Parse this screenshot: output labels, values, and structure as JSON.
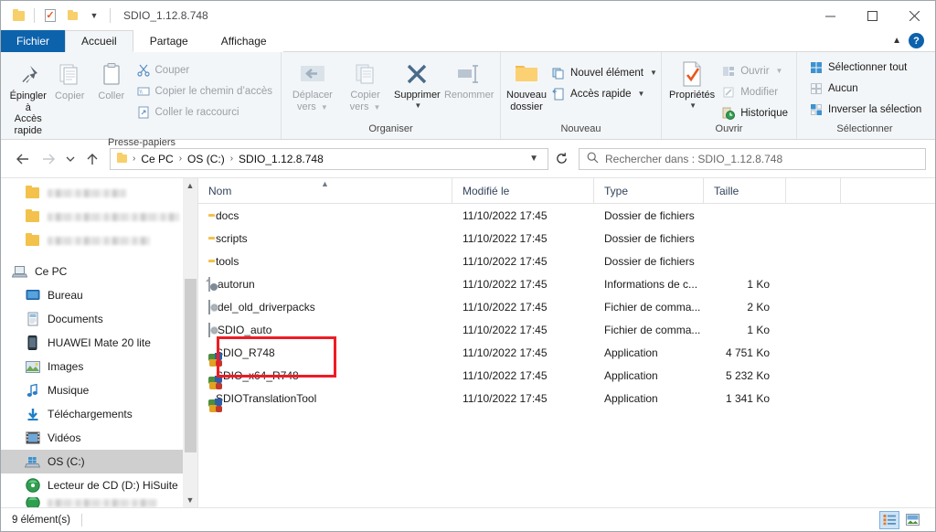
{
  "window": {
    "title": "SDIO_1.12.8.748",
    "controls": {
      "minimize": "—",
      "maximize": "□",
      "close": "✕"
    },
    "quick_access": {
      "folder_icon": "folder-icon",
      "properties_icon": "properties-icon",
      "new_folder_icon": "folder-icon",
      "dropdown_icon": "chevron-down-icon"
    }
  },
  "tabs": {
    "file": "Fichier",
    "items": [
      {
        "label": "Accueil",
        "active": true
      },
      {
        "label": "Partage",
        "active": false
      },
      {
        "label": "Affichage",
        "active": false
      }
    ],
    "collapse_icon": "chevron-up-icon",
    "help_label": "?"
  },
  "ribbon": {
    "groups": [
      {
        "name": "Presse-papiers",
        "big": [
          {
            "label_line1": "Épingler à",
            "label_line2": "Accès rapide",
            "icon": "pin-icon",
            "disabled": false
          },
          {
            "label_line1": "Copier",
            "label_line2": "",
            "icon": "copy-icon",
            "disabled": true
          },
          {
            "label_line1": "Coller",
            "label_line2": "",
            "icon": "paste-icon",
            "disabled": true
          }
        ],
        "small": [
          {
            "label": "Couper",
            "icon": "scissors-icon",
            "disabled": true
          },
          {
            "label": "Copier le chemin d’accès",
            "icon": "copy-path-icon",
            "disabled": true
          },
          {
            "label": "Coller le raccourci",
            "icon": "paste-shortcut-icon",
            "disabled": true
          }
        ]
      },
      {
        "name": "Organiser",
        "big": [
          {
            "label_line1": "Déplacer",
            "label_line2": "vers",
            "icon": "move-to-icon",
            "disabled": true,
            "caret": true
          },
          {
            "label_line1": "Copier",
            "label_line2": "vers",
            "icon": "copy-to-icon",
            "disabled": true,
            "caret": true
          },
          {
            "label_line1": "Supprimer",
            "label_line2": "",
            "icon": "delete-icon",
            "disabled": false,
            "caret": true
          },
          {
            "label_line1": "Renommer",
            "label_line2": "",
            "icon": "rename-icon",
            "disabled": true
          }
        ],
        "small": []
      },
      {
        "name": "Nouveau",
        "big": [
          {
            "label_line1": "Nouveau",
            "label_line2": "dossier",
            "icon": "new-folder-icon",
            "disabled": false
          }
        ],
        "small": [
          {
            "label": "Nouvel élément",
            "icon": "new-item-icon",
            "disabled": false,
            "caret": true
          },
          {
            "label": "Accès rapide",
            "icon": "easy-access-icon",
            "disabled": false,
            "caret": true
          }
        ]
      },
      {
        "name": "Ouvrir",
        "big": [
          {
            "label_line1": "Propriétés",
            "label_line2": "",
            "icon": "properties-icon",
            "disabled": false,
            "caret": true
          }
        ],
        "small": [
          {
            "label": "Ouvrir",
            "icon": "open-icon",
            "disabled": true,
            "caret": true
          },
          {
            "label": "Modifier",
            "icon": "edit-icon",
            "disabled": true
          },
          {
            "label": "Historique",
            "icon": "history-icon",
            "disabled": false
          }
        ]
      },
      {
        "name": "Sélectionner",
        "big": [],
        "small": [
          {
            "label": "Sélectionner tout",
            "icon": "select-all-icon",
            "disabled": false
          },
          {
            "label": "Aucun",
            "icon": "select-none-icon",
            "disabled": false
          },
          {
            "label": "Inverser la sélection",
            "icon": "invert-selection-icon",
            "disabled": false
          }
        ]
      }
    ]
  },
  "address": {
    "back_icon": "back-arrow-icon",
    "forward_icon": "forward-arrow-icon",
    "recent_icon": "chevron-down-icon",
    "up_icon": "up-arrow-icon",
    "breadcrumbs": [
      "Ce PC",
      "OS (C:)",
      "SDIO_1.12.8.748"
    ],
    "separator": "›",
    "dropdown_icon": "chevron-down-icon",
    "refresh_icon": "refresh-icon"
  },
  "search": {
    "icon": "search-icon",
    "placeholder": "Rechercher dans : SDIO_1.12.8.748"
  },
  "navpane": {
    "items": [
      {
        "label": "",
        "icon": "folder-icon",
        "blurred": true,
        "indent": "child",
        "blur_width": 86
      },
      {
        "label": "",
        "icon": "folder-icon",
        "blurred": true,
        "indent": "child",
        "blur_width": 144
      },
      {
        "label": "",
        "icon": "folder-icon",
        "blurred": true,
        "indent": "child",
        "blur_width": 112
      },
      {
        "label": "Ce PC",
        "icon": "computer-icon",
        "blurred": false,
        "indent": "root",
        "selected": false
      },
      {
        "label": "Bureau",
        "icon": "desktop-icon",
        "blurred": false,
        "indent": "child",
        "selected": false
      },
      {
        "label": "Documents",
        "icon": "documents-icon",
        "blurred": false,
        "indent": "child",
        "selected": false
      },
      {
        "label": "HUAWEI Mate 20 lite",
        "icon": "phone-icon",
        "blurred": false,
        "indent": "child",
        "selected": false
      },
      {
        "label": "Images",
        "icon": "pictures-icon",
        "blurred": false,
        "indent": "child",
        "selected": false
      },
      {
        "label": "Musique",
        "icon": "music-icon",
        "blurred": false,
        "indent": "child",
        "selected": false
      },
      {
        "label": "Téléchargements",
        "icon": "downloads-icon",
        "blurred": false,
        "indent": "child",
        "selected": false
      },
      {
        "label": "Vidéos",
        "icon": "videos-icon",
        "blurred": false,
        "indent": "child",
        "selected": false
      },
      {
        "label": "OS (C:)",
        "icon": "drive-icon",
        "blurred": false,
        "indent": "child",
        "selected": true
      },
      {
        "label": "Lecteur de CD (D:) HiSuite",
        "icon": "cd-drive-icon",
        "blurred": false,
        "indent": "child",
        "selected": false
      }
    ],
    "scroll_up_icon": "chevron-up-icon",
    "scroll_down_icon": "chevron-down-icon"
  },
  "filelist": {
    "columns": [
      {
        "label": "Nom",
        "sorted": true,
        "sort_icon": "sort-ascending-icon"
      },
      {
        "label": "Modifié le",
        "sorted": false
      },
      {
        "label": "Type",
        "sorted": false
      },
      {
        "label": "Taille",
        "sorted": false
      }
    ],
    "rows": [
      {
        "name": "docs",
        "modified": "11/10/2022 17:45",
        "type": "Dossier de fichiers",
        "size": "",
        "icon": "folder-icon"
      },
      {
        "name": "scripts",
        "modified": "11/10/2022 17:45",
        "type": "Dossier de fichiers",
        "size": "",
        "icon": "folder-icon"
      },
      {
        "name": "tools",
        "modified": "11/10/2022 17:45",
        "type": "Dossier de fichiers",
        "size": "",
        "icon": "folder-icon"
      },
      {
        "name": "autorun",
        "modified": "11/10/2022 17:45",
        "type": "Informations de c...",
        "size": "1 Ko",
        "icon": "config-file-icon"
      },
      {
        "name": "del_old_driverpacks",
        "modified": "11/10/2022 17:45",
        "type": "Fichier de comma...",
        "size": "2 Ko",
        "icon": "batch-file-icon"
      },
      {
        "name": "SDIO_auto",
        "modified": "11/10/2022 17:45",
        "type": "Fichier de comma...",
        "size": "1 Ko",
        "icon": "batch-file-icon"
      },
      {
        "name": "SDIO_R748",
        "modified": "11/10/2022 17:45",
        "type": "Application",
        "size": "4 751 Ko",
        "icon": "application-icon"
      },
      {
        "name": "SDIO_x64_R748",
        "modified": "11/10/2022 17:45",
        "type": "Application",
        "size": "5 232 Ko",
        "icon": "application-icon"
      },
      {
        "name": "SDIOTranslationTool",
        "modified": "11/10/2022 17:45",
        "type": "Application",
        "size": "1 341 Ko",
        "icon": "application-icon"
      }
    ]
  },
  "annotation": {
    "color": "#ee1c24",
    "highlights": [
      "SDIO_R748",
      "SDIO_x64_R748"
    ]
  },
  "statusbar": {
    "item_count": "9 élément(s)",
    "view_details_icon": "details-view-icon",
    "view_thumbnails_icon": "large-icons-view-icon"
  }
}
